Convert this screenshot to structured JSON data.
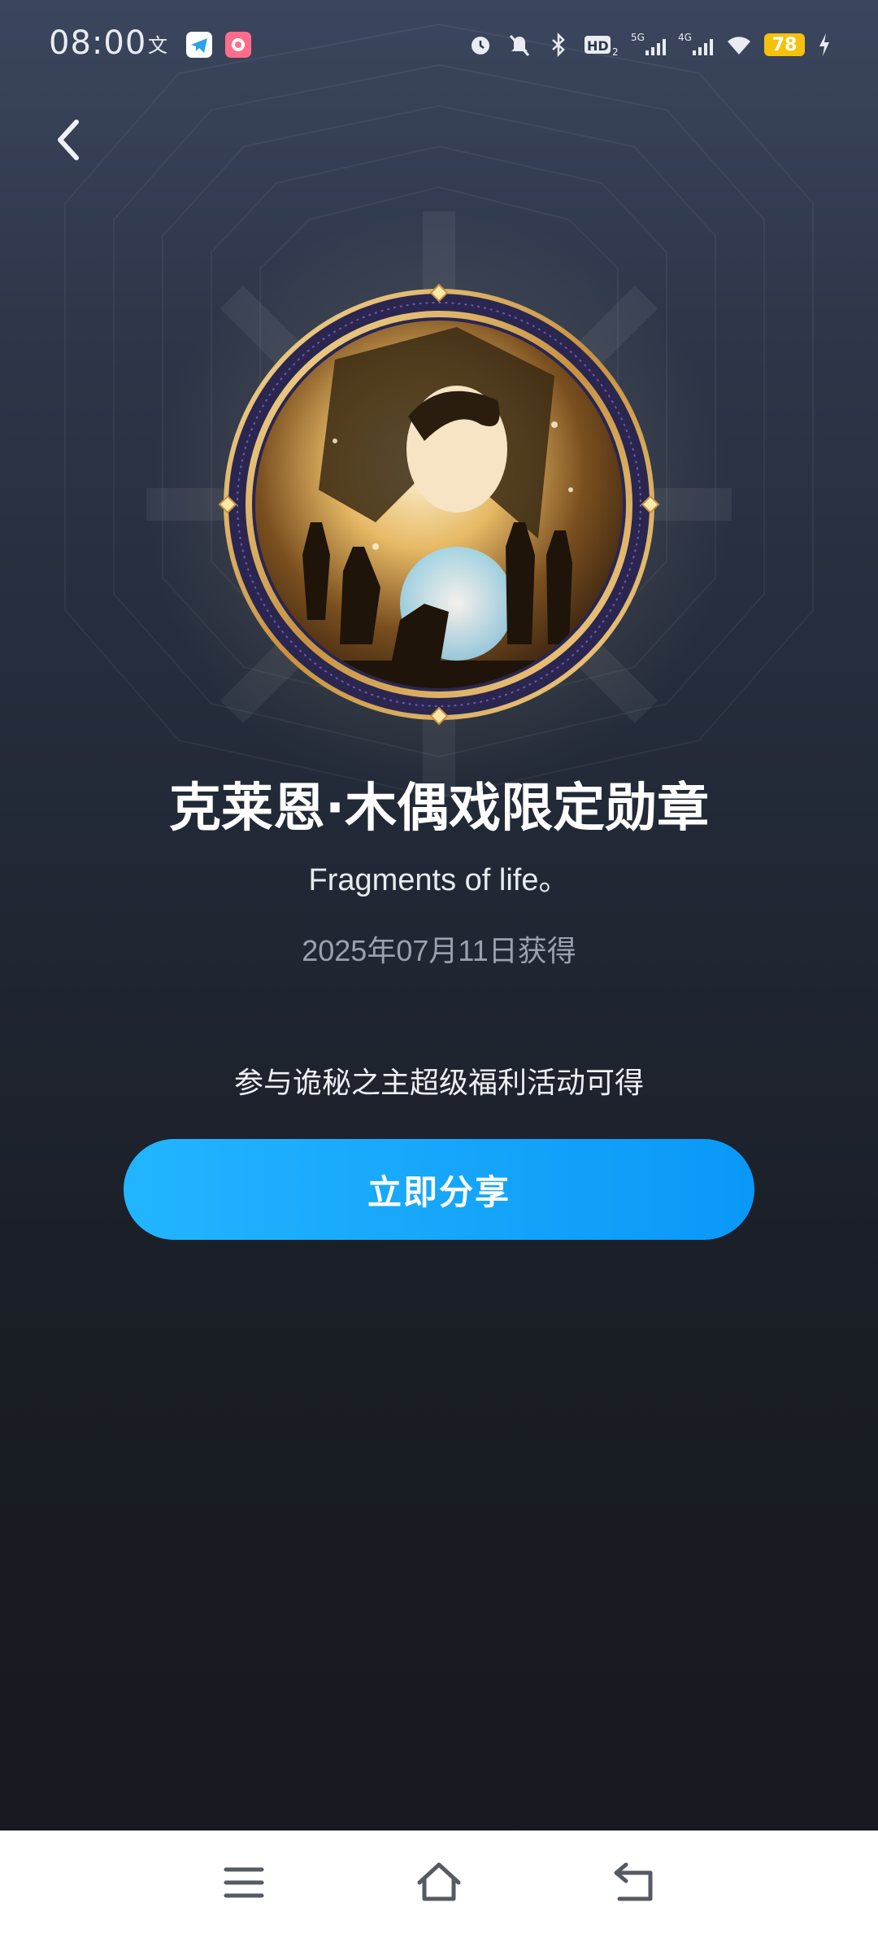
{
  "status_bar": {
    "time": "08:00",
    "battery_level": "78",
    "left_icons": [
      "translate-icon",
      "telegram-icon",
      "game-app-icon"
    ],
    "right_icons": [
      "alarm-icon",
      "mute-icon",
      "bluetooth-icon",
      "hd-icon",
      "5g-signal-icon",
      "4g-signal-icon",
      "wifi-icon",
      "battery-icon",
      "charging-icon"
    ]
  },
  "header": {
    "back_icon": "chevron-left-icon"
  },
  "medal": {
    "title": "克莱恩·木偶戏限定勋章",
    "subtitle": "Fragments of life。",
    "date": "2025年07月11日获得",
    "source": "参与诡秘之主超级福利活动可得"
  },
  "actions": {
    "share_label": "立即分享"
  },
  "nav_bar": {
    "items": [
      "menu-icon",
      "home-icon",
      "back-icon"
    ]
  },
  "colors": {
    "accent": "#0a98f7",
    "accent_light": "#22b5ff",
    "medal_gold": "#d9b46a",
    "medal_rim": "#2a2650"
  }
}
